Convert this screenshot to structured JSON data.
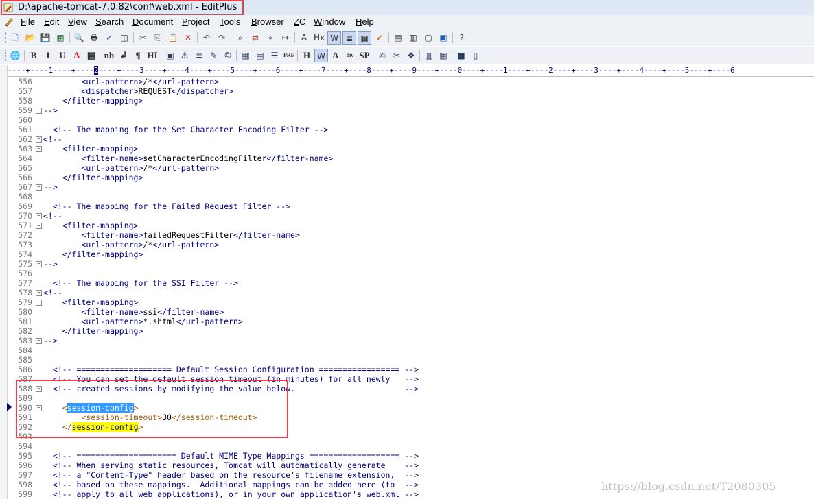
{
  "window": {
    "title": "D:\\apache-tomcat-7.0.82\\conf\\web.xml - EditPlus"
  },
  "menu": [
    {
      "u": "F",
      "rest": "ile"
    },
    {
      "u": "E",
      "rest": "dit"
    },
    {
      "u": "V",
      "rest": "iew"
    },
    {
      "u": "S",
      "rest": "earch"
    },
    {
      "u": "D",
      "rest": "ocument"
    },
    {
      "u": "P",
      "rest": "roject"
    },
    {
      "u": "T",
      "rest": "ools"
    },
    {
      "u": "B",
      "rest": "rowser"
    },
    {
      "u": "Z",
      "rest": "C"
    },
    {
      "u": "W",
      "rest": "indow"
    },
    {
      "u": "H",
      "rest": "elp"
    }
  ],
  "toolbar1": [
    "new-file-icon",
    "open-file-icon",
    "save-icon",
    "save-all-icon",
    "print-preview-icon",
    "print-icon",
    "spell-check-icon",
    "browser-preview-icon",
    "cut-icon",
    "copy-icon",
    "paste-icon",
    "delete-icon",
    "undo-icon",
    "redo-icon",
    "find-icon",
    "replace-icon",
    "find-in-files-icon",
    "goto-icon",
    "font-icon",
    "hex-icon",
    "word-wrap-icon",
    "line-number-icon",
    "column-icon",
    "spell-icon",
    "toolbar-icon",
    "cliptext-icon",
    "directory-icon",
    "output-icon",
    "help-icon"
  ],
  "toolbar2": [
    {
      "name": "browser-icon",
      "glyph": "🌐"
    },
    {
      "name": "bold-button",
      "glyph": "B"
    },
    {
      "name": "italic-button",
      "glyph": "I"
    },
    {
      "name": "underline-button",
      "glyph": "U"
    },
    {
      "name": "font-color-button",
      "glyph": "A"
    },
    {
      "name": "color-picker-button",
      "glyph": "▦"
    },
    {
      "name": "nbsp-button",
      "glyph": "nb"
    },
    {
      "name": "br-button",
      "glyph": "↲"
    },
    {
      "name": "paragraph-button",
      "glyph": "¶"
    },
    {
      "name": "heading-button",
      "glyph": "HI"
    },
    {
      "name": "image-button",
      "glyph": "▣"
    },
    {
      "name": "anchor-button",
      "glyph": "⚓"
    },
    {
      "name": "hr-button",
      "glyph": "≡"
    },
    {
      "name": "comment-button",
      "glyph": "✎"
    },
    {
      "name": "copyright-button",
      "glyph": "©"
    },
    {
      "name": "table-button",
      "glyph": "▦"
    },
    {
      "name": "form-button",
      "glyph": "▤"
    },
    {
      "name": "list-button",
      "glyph": "☰"
    },
    {
      "name": "pre-button",
      "glyph": "PRE"
    },
    {
      "name": "hx-button",
      "glyph": "H"
    },
    {
      "name": "w-button",
      "glyph": "W"
    },
    {
      "name": "a-button",
      "glyph": "A"
    },
    {
      "name": "div-button",
      "glyph": "div"
    },
    {
      "name": "sp-button",
      "glyph": "SP"
    },
    {
      "name": "edit-tag-button",
      "glyph": "✍"
    },
    {
      "name": "select-tag-button",
      "glyph": "✂"
    },
    {
      "name": "plugin-button",
      "glyph": "❖"
    },
    {
      "name": "frame-button",
      "glyph": "▥"
    },
    {
      "name": "grid-button",
      "glyph": "▦"
    },
    {
      "name": "color-button",
      "glyph": "■"
    },
    {
      "name": "layout-button",
      "glyph": "▯"
    }
  ],
  "ruler": {
    "before": "----+----1----+----",
    "cur": "2",
    "after": "----+----3----+----4----+----5----+----6----+----7----+----8----+----9----+----0----+----1----+----2----+----3----+----4----+----5----+----6"
  },
  "code_lines": [
    {
      "n": "556",
      "fold": "",
      "segs": [
        [
          "        ",
          "vl"
        ],
        [
          "<url-pattern>",
          "tg"
        ],
        [
          "/*",
          "vl"
        ],
        [
          "</url-pattern>",
          "tg"
        ]
      ]
    },
    {
      "n": "557",
      "fold": "",
      "segs": [
        [
          "        ",
          "vl"
        ],
        [
          "<dispatcher>",
          "tg"
        ],
        [
          "REQUEST",
          "vl"
        ],
        [
          "</dispatcher>",
          "tg"
        ]
      ]
    },
    {
      "n": "558",
      "fold": "",
      "segs": [
        [
          "    ",
          "vl"
        ],
        [
          "</filter-mapping>",
          "tg"
        ]
      ]
    },
    {
      "n": "559",
      "fold": "−",
      "segs": [
        [
          "-->",
          "tg"
        ]
      ]
    },
    {
      "n": "560",
      "fold": "",
      "segs": []
    },
    {
      "n": "561",
      "fold": "",
      "segs": [
        [
          "  ",
          "vl"
        ],
        [
          "<!-- The mapping for the Set Character Encoding Filter -->",
          "tg"
        ]
      ]
    },
    {
      "n": "562",
      "fold": "−",
      "segs": [
        [
          "<!--",
          "tg"
        ]
      ]
    },
    {
      "n": "563",
      "fold": "−",
      "segs": [
        [
          "    ",
          "vl"
        ],
        [
          "<filter-mapping>",
          "tg"
        ]
      ]
    },
    {
      "n": "564",
      "fold": "",
      "segs": [
        [
          "        ",
          "vl"
        ],
        [
          "<filter-name>",
          "tg"
        ],
        [
          "setCharacterEncodingFilter",
          "vl"
        ],
        [
          "</filter-name>",
          "tg"
        ]
      ]
    },
    {
      "n": "565",
      "fold": "",
      "segs": [
        [
          "        ",
          "vl"
        ],
        [
          "<url-pattern>",
          "tg"
        ],
        [
          "/*",
          "vl"
        ],
        [
          "</url-pattern>",
          "tg"
        ]
      ]
    },
    {
      "n": "566",
      "fold": "",
      "segs": [
        [
          "    ",
          "vl"
        ],
        [
          "</filter-mapping>",
          "tg"
        ]
      ]
    },
    {
      "n": "567",
      "fold": "−",
      "segs": [
        [
          "-->",
          "tg"
        ]
      ]
    },
    {
      "n": "568",
      "fold": "",
      "segs": []
    },
    {
      "n": "569",
      "fold": "",
      "segs": [
        [
          "  ",
          "vl"
        ],
        [
          "<!-- The mapping for the Failed Request Filter -->",
          "tg"
        ]
      ]
    },
    {
      "n": "570",
      "fold": "−",
      "segs": [
        [
          "<!--",
          "tg"
        ]
      ]
    },
    {
      "n": "571",
      "fold": "−",
      "segs": [
        [
          "    ",
          "vl"
        ],
        [
          "<filter-mapping>",
          "tg"
        ]
      ]
    },
    {
      "n": "572",
      "fold": "",
      "segs": [
        [
          "        ",
          "vl"
        ],
        [
          "<filter-name>",
          "tg"
        ],
        [
          "failedRequestFilter",
          "vl"
        ],
        [
          "</filter-name>",
          "tg"
        ]
      ]
    },
    {
      "n": "573",
      "fold": "",
      "segs": [
        [
          "        ",
          "vl"
        ],
        [
          "<url-pattern>",
          "tg"
        ],
        [
          "/*",
          "vl"
        ],
        [
          "</url-pattern>",
          "tg"
        ]
      ]
    },
    {
      "n": "574",
      "fold": "",
      "segs": [
        [
          "    ",
          "vl"
        ],
        [
          "</filter-mapping>",
          "tg"
        ]
      ]
    },
    {
      "n": "575",
      "fold": "−",
      "segs": [
        [
          "-->",
          "tg"
        ]
      ]
    },
    {
      "n": "576",
      "fold": "",
      "segs": []
    },
    {
      "n": "577",
      "fold": "",
      "segs": [
        [
          "  ",
          "vl"
        ],
        [
          "<!-- The mapping for the SSI Filter -->",
          "tg"
        ]
      ]
    },
    {
      "n": "578",
      "fold": "−",
      "segs": [
        [
          "<!--",
          "tg"
        ]
      ]
    },
    {
      "n": "579",
      "fold": "−",
      "segs": [
        [
          "    ",
          "vl"
        ],
        [
          "<filter-mapping>",
          "tg"
        ]
      ]
    },
    {
      "n": "580",
      "fold": "",
      "segs": [
        [
          "        ",
          "vl"
        ],
        [
          "<filter-name>",
          "tg"
        ],
        [
          "ssi",
          "vl"
        ],
        [
          "</filter-name>",
          "tg"
        ]
      ]
    },
    {
      "n": "581",
      "fold": "",
      "segs": [
        [
          "        ",
          "vl"
        ],
        [
          "<url-pattern>",
          "tg"
        ],
        [
          "*.shtml",
          "vl"
        ],
        [
          "</url-pattern>",
          "tg"
        ]
      ]
    },
    {
      "n": "582",
      "fold": "",
      "segs": [
        [
          "    ",
          "vl"
        ],
        [
          "</filter-mapping>",
          "tg"
        ]
      ]
    },
    {
      "n": "583",
      "fold": "−",
      "segs": [
        [
          "-->",
          "tg"
        ]
      ]
    },
    {
      "n": "584",
      "fold": "",
      "segs": []
    },
    {
      "n": "585",
      "fold": "",
      "segs": []
    },
    {
      "n": "586",
      "fold": "",
      "segs": [
        [
          "  ",
          "vl"
        ],
        [
          "<!-- ==================== Default Session Configuration ================= -->",
          "tg"
        ]
      ]
    },
    {
      "n": "587",
      "fold": "",
      "segs": [
        [
          "  ",
          "vl"
        ],
        [
          "<!-- You can set the default session timeout (in minutes) for all newly   -->",
          "tg"
        ]
      ]
    },
    {
      "n": "588",
      "fold": "−",
      "segs": [
        [
          "  ",
          "vl"
        ],
        [
          "<!-- created sessions by modifying the value below.                       -->",
          "tg"
        ]
      ]
    },
    {
      "n": "589",
      "fold": "",
      "segs": []
    },
    {
      "n": "590",
      "fold": "−",
      "segs": [
        [
          "    ",
          "vl"
        ],
        [
          "<",
          "tg2"
        ],
        [
          "session-config",
          "sel"
        ],
        [
          ">",
          "tg2"
        ]
      ]
    },
    {
      "n": "591",
      "fold": "",
      "segs": [
        [
          "        ",
          "vl"
        ],
        [
          "<session-timeout>",
          "tg2"
        ],
        [
          "30",
          "vl"
        ],
        [
          "</session-timeout>",
          "tg2"
        ]
      ]
    },
    {
      "n": "592",
      "fold": "",
      "segs": [
        [
          "    ",
          "vl"
        ],
        [
          "</",
          "tg2"
        ],
        [
          "session-config",
          "yel"
        ],
        [
          ">",
          "tg2"
        ]
      ]
    },
    {
      "n": "593",
      "fold": "",
      "segs": []
    },
    {
      "n": "594",
      "fold": "",
      "segs": []
    },
    {
      "n": "595",
      "fold": "",
      "segs": [
        [
          "  ",
          "vl"
        ],
        [
          "<!-- ===================== Default MIME Type Mappings =================== -->",
          "tg"
        ]
      ]
    },
    {
      "n": "596",
      "fold": "",
      "segs": [
        [
          "  ",
          "vl"
        ],
        [
          "<!-- When serving static resources, Tomcat will automatically generate    -->",
          "tg"
        ]
      ]
    },
    {
      "n": "597",
      "fold": "",
      "segs": [
        [
          "  ",
          "vl"
        ],
        [
          "<!-- a \"Content-Type\" header based on the resource's filename extension,  -->",
          "tg"
        ]
      ]
    },
    {
      "n": "598",
      "fold": "",
      "segs": [
        [
          "  ",
          "vl"
        ],
        [
          "<!-- based on these mappings.  Additional mappings can be added here (to  -->",
          "tg"
        ]
      ]
    },
    {
      "n": "599",
      "fold": "",
      "segs": [
        [
          "  ",
          "vl"
        ],
        [
          "<!-- apply to all web applications), or in your own application's web.xml -->",
          "tg"
        ]
      ]
    }
  ],
  "watermark": "https://blog.csdn.net/T2080305"
}
